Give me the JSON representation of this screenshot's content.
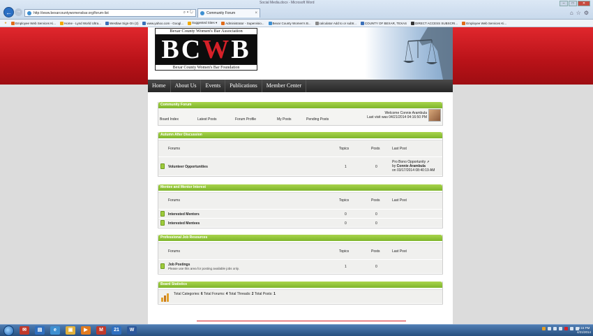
{
  "browser": {
    "window_title": "Social Media.docx - Microsoft Word",
    "url": "http://www.bexarcountywomensbar.org/forum-list",
    "address_tools": "⌕ ▾ ↻",
    "tab_title": "Community Forum",
    "tab_close": "×",
    "win_min": "–",
    "win_max": "□",
    "win_close": "✕",
    "chrome_icons": [
      "⌂",
      "☆",
      "⚙"
    ],
    "favorites": [
      {
        "label": "Employee Web Services Ki...",
        "color": "#e06b1a"
      },
      {
        "label": "Home - Lynd World Ultra...",
        "color": "#f2a900"
      },
      {
        "label": "Westlaw Sign-On (2)",
        "color": "#3a6fb8"
      },
      {
        "label": "www.yahoo.com - Googl...",
        "color": "#3a6fb8"
      },
      {
        "label": "Suggested Sites ▾",
        "color": "#f2a900"
      },
      {
        "label": "Administrator - Supervisio...",
        "color": "#e06b1a"
      },
      {
        "label": "Bexar County Women's B...",
        "color": "#3d8fd1"
      },
      {
        "label": "calculator Add to or subtr...",
        "color": "#888888"
      },
      {
        "label": "COUNTY OF BEXAR, TEXAS",
        "color": "#3a6fb8"
      },
      {
        "label": "DIRECT ACCESS SUBSCRI...",
        "color": "#333333"
      },
      {
        "label": "Employee Web Services Ki...",
        "color": "#e06b1a"
      }
    ]
  },
  "site": {
    "logo_top": "Bexar County Women's Bar Association",
    "logo_letters": [
      "BC",
      "W",
      "B"
    ],
    "logo_bottom": "Bexar County Women's Bar Foundation",
    "nav": [
      "Home",
      "About Us",
      "Events",
      "Publications",
      "Member Center"
    ]
  },
  "community": {
    "header": "Community Forum",
    "links": [
      "Board Index",
      "Latest Posts",
      "Forum Profile",
      "My Posts",
      "Pending Posts"
    ],
    "welcome": "Welcome Connie Arambula",
    "last_visit": "Last visit was 04/21/2014 04:16:50 PM"
  },
  "columns": {
    "forums": "Forums",
    "topics": "Topics",
    "posts": "Posts",
    "last_post": "Last Post"
  },
  "sections": [
    {
      "title": "Autumn After Discussion",
      "forums": [
        {
          "name": "Volunteer Opportunities",
          "desc": "",
          "topics": "1",
          "posts": "0",
          "last_title": "Pro Bono Opportunity ⇗",
          "last_by_prefix": "by ",
          "last_by": "Connie Arambula",
          "last_on": "on 03/17/2014 08:40:19 AM"
        }
      ]
    },
    {
      "title": "Mentee and Mentor Interest",
      "forums": [
        {
          "name": "Interested Mentors",
          "desc": "",
          "topics": "0",
          "posts": "0"
        },
        {
          "name": "Interested Mentees",
          "desc": "",
          "topics": "0",
          "posts": "0"
        }
      ]
    },
    {
      "title": "Professional Job Resources",
      "forums": [
        {
          "name": "Job Postings",
          "desc": "Please use this area for posting available jobs only.",
          "topics": "1",
          "posts": "0"
        }
      ]
    }
  ],
  "stats": {
    "title": "Board Statistics",
    "text_parts": [
      "Total Categories: ",
      "6",
      " Total Forums: ",
      "4",
      " Total Threads: ",
      "2",
      " Total Posts: ",
      "1"
    ]
  },
  "taskbar": {
    "apps": [
      {
        "name": "outlook",
        "label": "✉",
        "color": "#c0392b"
      },
      {
        "name": "pdf",
        "label": "▤",
        "color": "#2f6fbf"
      },
      {
        "name": "ie",
        "label": "e",
        "color": "#3d8fd1"
      },
      {
        "name": "explorer",
        "label": "▣",
        "color": "#e2b13c"
      },
      {
        "name": "media",
        "label": "▶",
        "color": "#e07a1f"
      },
      {
        "name": "gmail",
        "label": "M",
        "color": "#c0392b"
      },
      {
        "name": "calendar",
        "label": "21",
        "color": "#2f6fbf"
      },
      {
        "name": "word",
        "label": "W",
        "color": "#2b579a"
      }
    ],
    "time": "4:15 PM",
    "date": "4/21/2014"
  }
}
